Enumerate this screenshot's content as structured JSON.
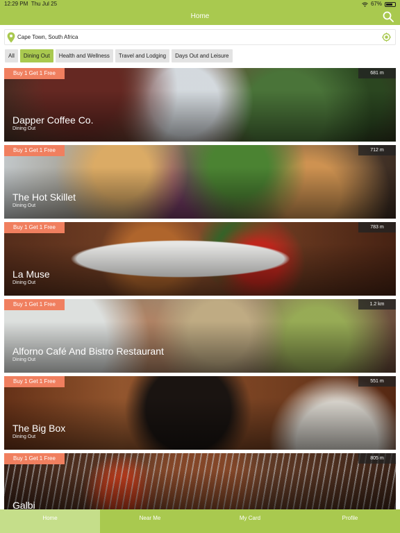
{
  "status": {
    "time": "12:29 PM",
    "date": "Thu Jul 25",
    "battery": "67%"
  },
  "header": {
    "title": "Home"
  },
  "location": {
    "value": "Cape Town, South Africa"
  },
  "filters": [
    {
      "label": "All",
      "active": false
    },
    {
      "label": "Dining Out",
      "active": true
    },
    {
      "label": "Health and Wellness",
      "active": false
    },
    {
      "label": "Travel and Lodging",
      "active": false
    },
    {
      "label": "Days Out and Leisure",
      "active": false
    }
  ],
  "listings": [
    {
      "promo": "Buy 1 Get 1 Free",
      "distance": "681 m",
      "name": "Dapper Coffee Co.",
      "category": "Dining Out"
    },
    {
      "promo": "Buy 1 Get 1 Free",
      "distance": "712 m",
      "name": "The Hot Skillet",
      "category": "Dining Out"
    },
    {
      "promo": "Buy 1 Get 1 Free",
      "distance": "783 m",
      "name": "La Muse",
      "category": "Dining Out"
    },
    {
      "promo": "Buy 1 Get 1 Free",
      "distance": "1.2 km",
      "name": "Alforno Café And Bistro Restaurant",
      "category": "Dining Out"
    },
    {
      "promo": "Buy 1 Get 1 Free",
      "distance": "551 m",
      "name": "The Big Box",
      "category": "Dining Out"
    },
    {
      "promo": "Buy 1 Get 1 Free",
      "distance": "805 m",
      "name": "Galbi",
      "category": ""
    }
  ],
  "tabs": [
    {
      "label": "Home",
      "active": true
    },
    {
      "label": "Near Me",
      "active": false
    },
    {
      "label": "My Card",
      "active": false
    },
    {
      "label": "Profile",
      "active": false
    }
  ],
  "colors": {
    "brand": "#a9c94f",
    "promo": "#f07f5f",
    "tab_active": "#c5de8a"
  }
}
